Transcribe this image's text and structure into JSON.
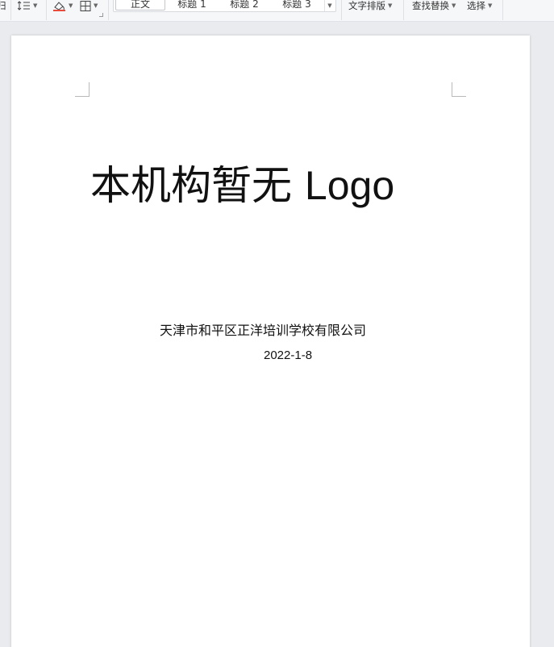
{
  "toolbar": {
    "partial_left_glyph": "归",
    "line_spacing_icon": "line-spacing-icon",
    "shading_icon": "shading-icon",
    "borders_icon": "borders-icon",
    "styles": [
      {
        "label": "正文",
        "selected": true
      },
      {
        "label": "标题 1",
        "selected": false
      },
      {
        "label": "标题 2",
        "selected": false
      },
      {
        "label": "标题 3",
        "selected": false
      }
    ],
    "text_layout_label": "文字排版",
    "find_replace_label": "查找替换",
    "select_label": "选择"
  },
  "document": {
    "heading_cjk": "本机构暂无",
    "heading_latin": "Logo",
    "organization": "天津市和平区正洋培训学校有限公司",
    "date": "2022-1-8"
  }
}
